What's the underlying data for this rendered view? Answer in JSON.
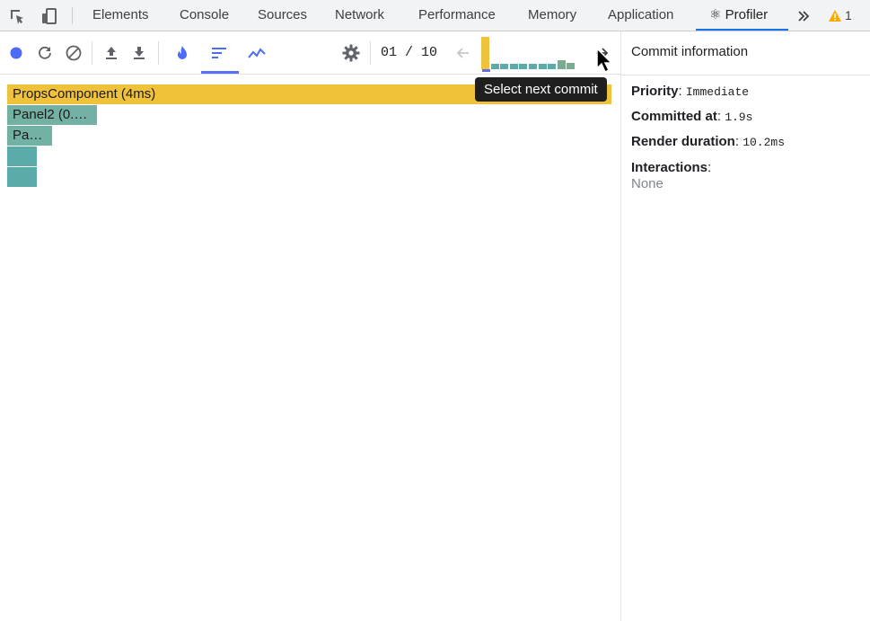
{
  "devtools": {
    "tabs": [
      {
        "label": "Elements"
      },
      {
        "label": "Console"
      },
      {
        "label": "Sources"
      },
      {
        "label": "Network"
      },
      {
        "label": "Performance"
      },
      {
        "label": "Memory"
      },
      {
        "label": "Application"
      },
      {
        "label": "⚛ Profiler"
      }
    ],
    "active_tab": "⚛ Profiler",
    "warning_count": "1",
    "accent_color": "#1a73e8"
  },
  "profiler": {
    "commit_counter": "01 / 10",
    "selected_commit_index": 1,
    "commit_bars": [
      {
        "color": "#f0c23b",
        "height": 1.0
      },
      {
        "color": "#5aaba9",
        "height": 0.17
      },
      {
        "color": "#5aaba9",
        "height": 0.17
      },
      {
        "color": "#5aaba9",
        "height": 0.17
      },
      {
        "color": "#5aaba9",
        "height": 0.17
      },
      {
        "color": "#5aaba9",
        "height": 0.17
      },
      {
        "color": "#5aaba9",
        "height": 0.17
      },
      {
        "color": "#5aaba9",
        "height": 0.17
      },
      {
        "color": "#78ad8f",
        "height": 0.28
      },
      {
        "color": "#78ad8f",
        "height": 0.2
      }
    ],
    "tooltip": "Select next commit",
    "flamegraph": [
      {
        "label": "PropsComponent (4ms)",
        "color": "#f0c23b"
      },
      {
        "label": "Panel2 (0.…",
        "color": "#72b1a3"
      },
      {
        "label": "Pa…",
        "color": "#72b1a3"
      },
      {
        "label": "",
        "color": "#5aaba9"
      },
      {
        "label": "",
        "color": "#5aaba9"
      }
    ]
  },
  "commit_info": {
    "title": "Commit information",
    "priority_label": "Priority",
    "priority_value": "Immediate",
    "committed_label": "Committed at",
    "committed_value": "1.9s",
    "render_label": "Render duration",
    "render_value": "10.2ms",
    "interactions_label": "Interactions",
    "interactions_value": "None"
  }
}
